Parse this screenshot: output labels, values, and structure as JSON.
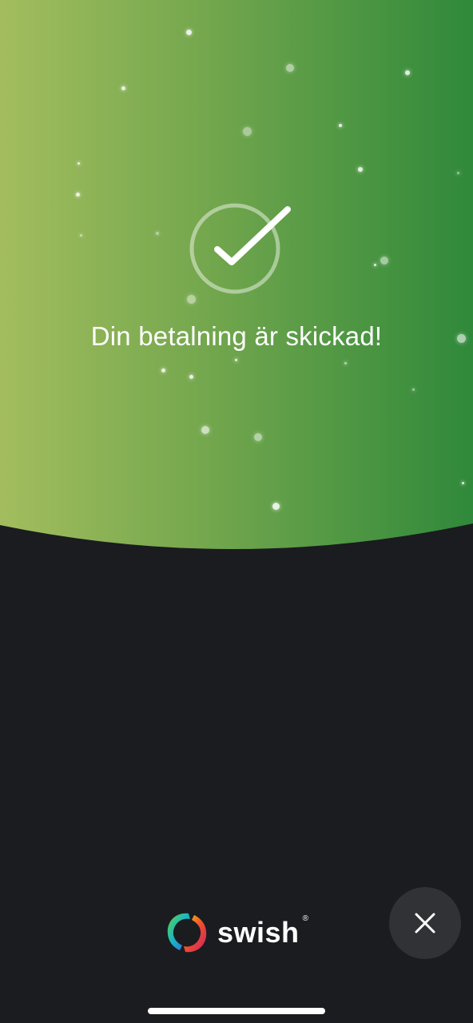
{
  "confirmation": {
    "message": "Din betalning är skickad!"
  },
  "icons": {
    "success": "checkmark-circle-icon",
    "close": "close-icon",
    "brand": "swish-logo-icon"
  },
  "brand": {
    "name": "swish",
    "registered_mark": "®"
  },
  "colors": {
    "gradient_left": "#a3bd5e",
    "gradient_right": "#2f893a",
    "background": "#1b1c1f",
    "close_button": "#303236",
    "text": "#ffffff"
  }
}
